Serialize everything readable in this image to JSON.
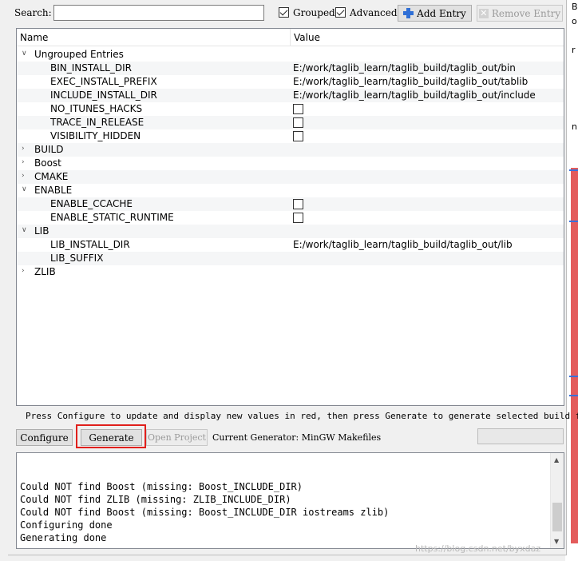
{
  "toolbar": {
    "search_label": "Search:",
    "search_value": "",
    "grouped_label": "Grouped",
    "grouped_checked": true,
    "advanced_label": "Advanced",
    "advanced_checked": true,
    "add_entry_label": "Add Entry",
    "remove_entry_label": "Remove Entry"
  },
  "table": {
    "header_name": "Name",
    "header_value": "Value",
    "rows": [
      {
        "kind": "group",
        "expanded": true,
        "name": "Ungrouped Entries",
        "value": ""
      },
      {
        "kind": "entry",
        "name": "BIN_INSTALL_DIR",
        "value": "E:/work/taglib_learn/taglib_build/taglib_out/bin"
      },
      {
        "kind": "entry",
        "name": "EXEC_INSTALL_PREFIX",
        "value": "E:/work/taglib_learn/taglib_build/taglib_out/tablib"
      },
      {
        "kind": "entry",
        "name": "INCLUDE_INSTALL_DIR",
        "value": "E:/work/taglib_learn/taglib_build/taglib_out/include"
      },
      {
        "kind": "bool",
        "name": "NO_ITUNES_HACKS",
        "value": ""
      },
      {
        "kind": "bool",
        "name": "TRACE_IN_RELEASE",
        "value": ""
      },
      {
        "kind": "bool",
        "name": "VISIBILITY_HIDDEN",
        "value": ""
      },
      {
        "kind": "group",
        "expanded": false,
        "name": "BUILD",
        "value": ""
      },
      {
        "kind": "group",
        "expanded": false,
        "name": "Boost",
        "value": ""
      },
      {
        "kind": "group",
        "expanded": false,
        "name": "CMAKE",
        "value": ""
      },
      {
        "kind": "group",
        "expanded": true,
        "name": "ENABLE",
        "value": ""
      },
      {
        "kind": "bool",
        "name": "ENABLE_CCACHE",
        "value": ""
      },
      {
        "kind": "bool",
        "name": "ENABLE_STATIC_RUNTIME",
        "value": ""
      },
      {
        "kind": "group",
        "expanded": true,
        "name": "LIB",
        "value": ""
      },
      {
        "kind": "entry",
        "name": "LIB_INSTALL_DIR",
        "value": "E:/work/taglib_learn/taglib_build/taglib_out/lib"
      },
      {
        "kind": "entry",
        "name": "LIB_SUFFIX",
        "value": ""
      },
      {
        "kind": "group",
        "expanded": false,
        "name": "ZLIB",
        "value": ""
      }
    ]
  },
  "hint_text": "Press Configure to update and display new values in red, then press Generate to generate selected build files.",
  "actions": {
    "configure_label": "Configure",
    "generate_label": "Generate",
    "open_project_label": "Open Project",
    "current_generator": "Current Generator: MinGW Makefiles"
  },
  "log": {
    "lines": [
      "Could NOT find Boost (missing: Boost_INCLUDE_DIR)",
      "Could NOT find ZLIB (missing: ZLIB_INCLUDE_DIR)",
      "Could NOT find Boost (missing: Boost_INCLUDE_DIR iostreams zlib)",
      "Configuring done",
      "Generating done"
    ]
  },
  "background": {
    "right_edge_text": [
      "B",
      "o",
      "r",
      "n"
    ],
    "watermark": "https://blog.csdn.net/byxdaz"
  },
  "colors": {
    "highlight_border": "#e0201c",
    "add_icon": "#2f6fd6"
  }
}
